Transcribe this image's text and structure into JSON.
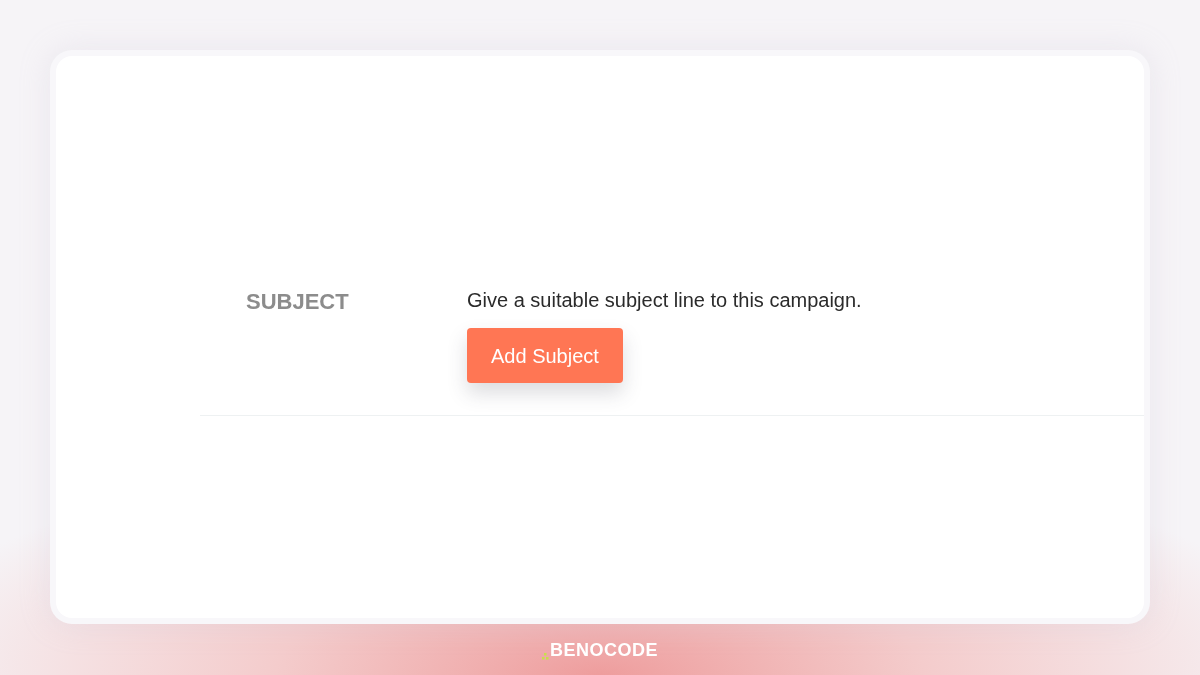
{
  "section": {
    "label": "SUBJECT",
    "description": "Give a suitable subject line to this campaign.",
    "button": {
      "label": "Add Subject"
    }
  },
  "footer": {
    "brand": "BENOCODE"
  }
}
